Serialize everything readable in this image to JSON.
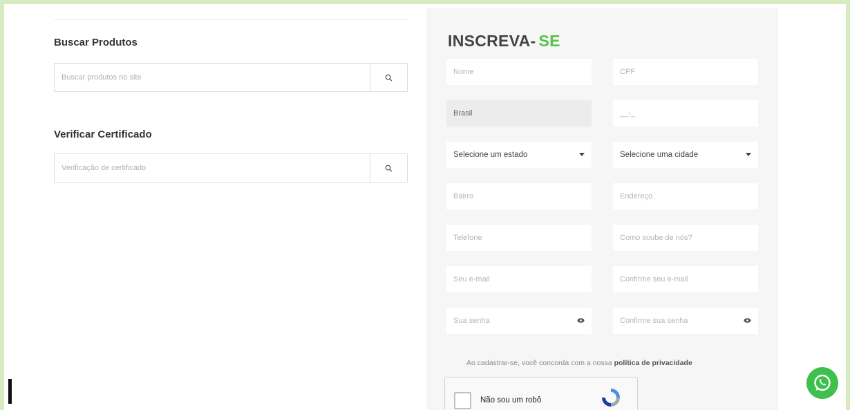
{
  "search_products": {
    "title": "Buscar Produtos",
    "placeholder": "Buscar produtos no site"
  },
  "verify_certificate": {
    "title": "Verificar Certificado",
    "placeholder": "Verificação de certificado"
  },
  "signup": {
    "title_main": "INSCREVA-",
    "title_accent": "SE",
    "fields": {
      "nome": "Nome",
      "cpf": "CPF",
      "country_value": "Brasil",
      "phone_mask": "__-_",
      "state_select": "Selecione um estado",
      "city_select": "Selecione uma cidade",
      "bairro": "Bairro",
      "endereco": "Endereço",
      "telefone": "Telefone",
      "como_soube": "Como soube de nós?",
      "email": "Seu e-mail",
      "confirm_email": "Confirme seu e-mail",
      "senha": "Sua senha",
      "confirm_senha": "Confirme sua senha"
    },
    "terms_prefix": "Ao cadastrar-se, você concorda com a nossa",
    "terms_link": "política de privacidade",
    "captcha_label": "Não sou um robô"
  },
  "colors": {
    "accent_green": "#57c24d",
    "whatsapp_green": "#3fc04e",
    "frame_border": "#d6ecc0"
  },
  "icons": [
    "search-icon",
    "chevron-down-icon",
    "eye-icon",
    "recaptcha-icon",
    "whatsapp-icon"
  ]
}
